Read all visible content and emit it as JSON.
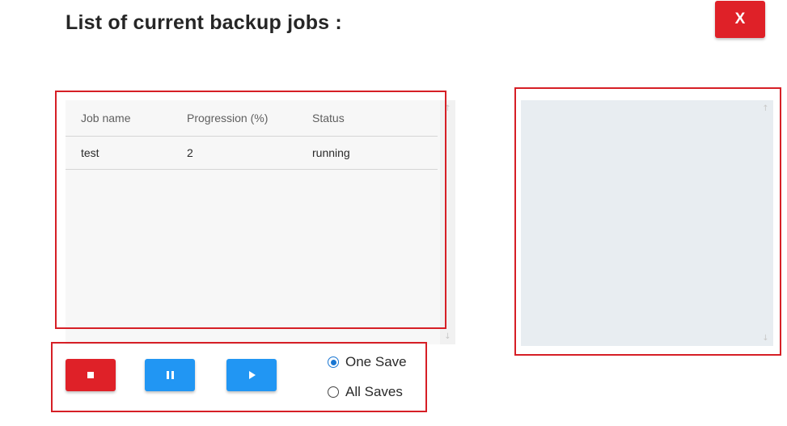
{
  "title": "List of current backup jobs :",
  "close_button": {
    "label": "X",
    "color": "#df2128"
  },
  "jobs_table": {
    "columns": [
      "Job name",
      "Progression (%)",
      "Status"
    ],
    "rows": [
      {
        "job_name": "test",
        "progression": "2",
        "status": "running"
      }
    ]
  },
  "scroll": {
    "up_icon": "arrow-up-icon",
    "down_icon": "arrow-down-icon"
  },
  "controls": {
    "stop_icon": "stop-icon",
    "pause_icon": "pause-icon",
    "play_icon": "play-icon",
    "stop_color": "#df2128",
    "action_color": "#2196f3"
  },
  "save_mode": {
    "options": [
      "One Save",
      "All Saves"
    ],
    "selected": "One Save"
  },
  "colors": {
    "highlight_border": "#d61f26",
    "log_background": "#e8edf1",
    "table_background": "#f7f7f7"
  }
}
